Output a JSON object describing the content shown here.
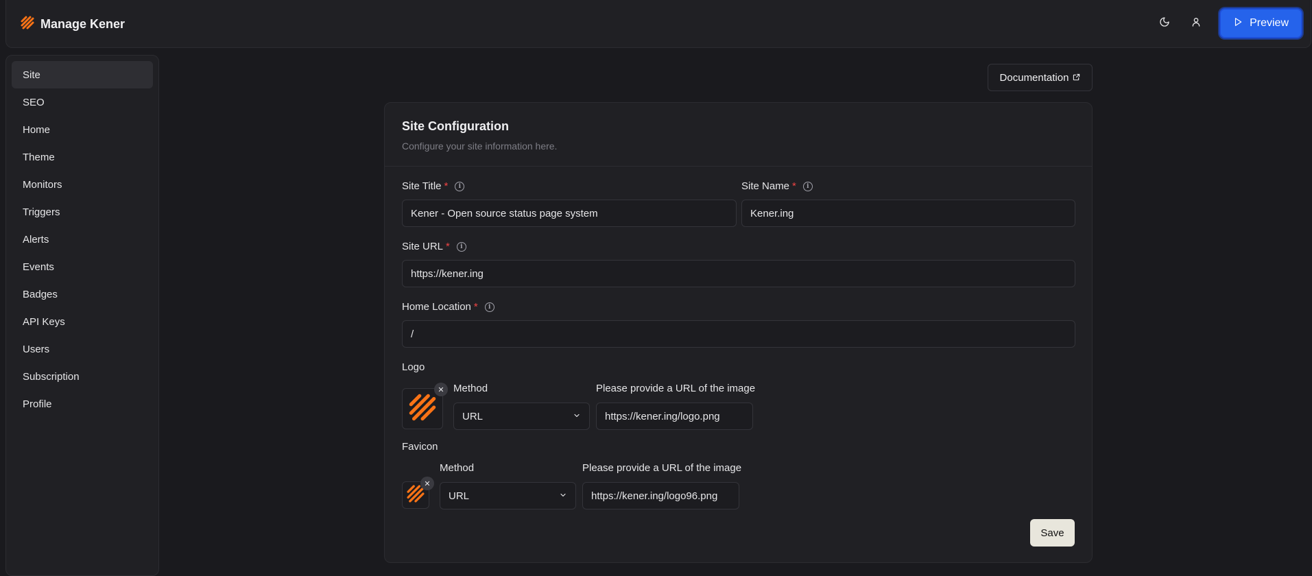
{
  "app": {
    "title": "Manage Kener"
  },
  "header": {
    "preview_label": "Preview",
    "theme_icon": "moon-icon",
    "user_icon": "user-icon"
  },
  "sidebar": {
    "items": [
      {
        "label": "Site"
      },
      {
        "label": "SEO"
      },
      {
        "label": "Home"
      },
      {
        "label": "Theme"
      },
      {
        "label": "Monitors"
      },
      {
        "label": "Triggers"
      },
      {
        "label": "Alerts"
      },
      {
        "label": "Events"
      },
      {
        "label": "Badges"
      },
      {
        "label": "API Keys"
      },
      {
        "label": "Users"
      },
      {
        "label": "Subscription"
      },
      {
        "label": "Profile"
      }
    ],
    "active": "Site"
  },
  "documentation": {
    "label": "Documentation"
  },
  "card": {
    "title": "Site Configuration",
    "description": "Configure your site information here.",
    "required_mark": "*",
    "site_title": {
      "label": "Site Title",
      "value": "Kener - Open source status page system"
    },
    "site_name": {
      "label": "Site Name",
      "value": "Kener.ing"
    },
    "site_url": {
      "label": "Site URL",
      "value": "https://kener.ing"
    },
    "home_location": {
      "label": "Home Location",
      "value": "/"
    },
    "logo": {
      "label": "Logo",
      "method_label": "Method",
      "method_value": "URL",
      "url_label": "Please provide a URL of the image",
      "url_value": "https://kener.ing/logo.png"
    },
    "favicon": {
      "label": "Favicon",
      "method_label": "Method",
      "method_value": "URL",
      "url_label": "Please provide a URL of the image",
      "url_value": "https://kener.ing/logo96.png"
    },
    "save_label": "Save"
  },
  "colors": {
    "accent": "#2563eb",
    "brand": "#f97316",
    "required": "#ef4444",
    "background": "#1a1a1e"
  }
}
